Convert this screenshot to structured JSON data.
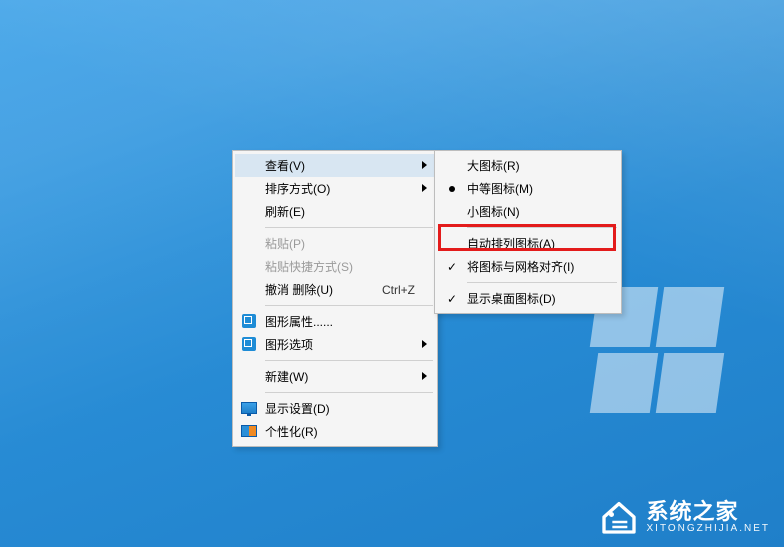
{
  "menu": {
    "items": [
      {
        "label": "查看(V)",
        "submenu": true,
        "hover": true
      },
      {
        "label": "排序方式(O)",
        "submenu": true
      },
      {
        "label": "刷新(E)"
      },
      {
        "sep": true
      },
      {
        "label": "粘贴(P)",
        "disabled": true
      },
      {
        "label": "粘贴快捷方式(S)",
        "disabled": true
      },
      {
        "label": "撤消 删除(U)",
        "shortcut": "Ctrl+Z"
      },
      {
        "sep": true
      },
      {
        "label": "图形属性......",
        "icon": "intel-graphics-icon"
      },
      {
        "label": "图形选项",
        "icon": "intel-graphics-icon",
        "submenu": true
      },
      {
        "sep": true
      },
      {
        "label": "新建(W)",
        "submenu": true
      },
      {
        "sep": true
      },
      {
        "label": "显示设置(D)",
        "icon": "monitor-icon"
      },
      {
        "label": "个性化(R)",
        "icon": "personalize-icon"
      }
    ]
  },
  "submenu": {
    "items": [
      {
        "label": "大图标(R)"
      },
      {
        "label": "中等图标(M)",
        "dot": true
      },
      {
        "label": "小图标(N)"
      },
      {
        "sep": true
      },
      {
        "label": "自动排列图标(A)",
        "highlight": true
      },
      {
        "label": "将图标与网格对齐(I)",
        "check": true
      },
      {
        "sep": true
      },
      {
        "label": "显示桌面图标(D)",
        "check": true
      }
    ]
  },
  "watermark": {
    "title": "系统之家",
    "url": "XITONGZHIJIA.NET"
  }
}
